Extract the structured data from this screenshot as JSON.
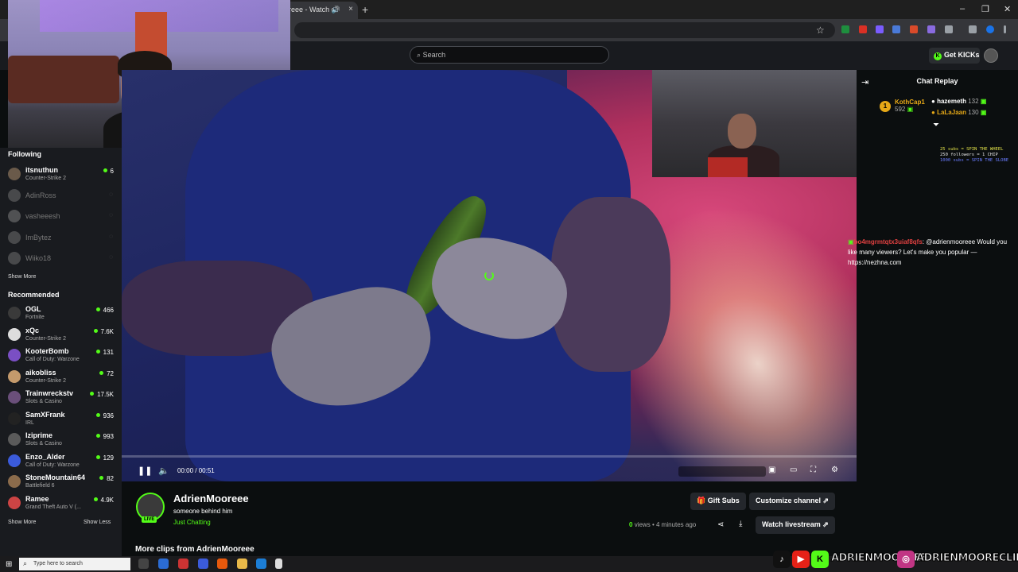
{
  "browser": {
    "tab_title": "reee - Watch cli",
    "speaker_icon": "speaker-icon",
    "close_icon": "×",
    "newtab": "+",
    "win_min": "–",
    "win_max": "❐",
    "win_close": "✕",
    "star": "☆"
  },
  "header": {
    "search_placeholder": "Search",
    "get_kicks": "Get KICKs",
    "accent": "#53fc18"
  },
  "sidebar": {
    "following_title": "Following",
    "following": [
      {
        "name": "itsnuthun",
        "game": "Counter-Strike 2",
        "viewers": "6",
        "live": true
      },
      {
        "name": "AdinRoss",
        "live": false
      },
      {
        "name": "vasheeesh",
        "live": false
      },
      {
        "name": "ImBytez",
        "live": false
      },
      {
        "name": "Wiiko18",
        "live": false
      }
    ],
    "show_more_1": "Show More",
    "recommended_title": "Recommended",
    "recommended": [
      {
        "name": "OGL",
        "game": "Fortnite",
        "viewers": "466"
      },
      {
        "name": "xQc",
        "game": "Counter-Strike 2",
        "viewers": "7.6K"
      },
      {
        "name": "KooterBomb",
        "game": "Call of Duty: Warzone",
        "viewers": "131"
      },
      {
        "name": "aikobliss",
        "game": "Counter-Strike 2",
        "viewers": "72"
      },
      {
        "name": "Trainwreckstv",
        "game": "Slots & Casino",
        "viewers": "17.5K"
      },
      {
        "name": "SamXFrank",
        "game": "IRL",
        "viewers": "936"
      },
      {
        "name": "Iziprime",
        "game": "Slots & Casino",
        "viewers": "993"
      },
      {
        "name": "Enzo_Alder",
        "game": "Call of Duty: Warzone",
        "viewers": "129"
      },
      {
        "name": "StoneMountain64",
        "game": "Battlefield 6",
        "viewers": "82"
      },
      {
        "name": "Ramee",
        "game": "Grand Theft Auto V (...",
        "viewers": "4.9K"
      }
    ],
    "show_more_2": "Show More",
    "show_less": "Show Less"
  },
  "player": {
    "current_time": "00:00",
    "separator": "/",
    "duration": "00:51",
    "progress": 0.0
  },
  "chat": {
    "title": "Chat Replay",
    "top_gifters": [
      {
        "rank": "1",
        "name": "KothCap1",
        "subs": "592",
        "color": "#e6a817"
      },
      {
        "name": "hazemeth",
        "subs": "132",
        "color": "#ffffff"
      },
      {
        "name": "LaLaJaan",
        "subs": "130",
        "color": "#e6a817"
      }
    ],
    "overlay_lines": [
      {
        "text": "25 subs = SPIN THE WHEEL",
        "color": "#e6e64a"
      },
      {
        "text": "250 followers = 1 CHIP",
        "color": "#e6e6e6"
      },
      {
        "text": "1000 subs = SPIN THE SLOBE",
        "color": "#6a7cff"
      }
    ],
    "message": {
      "user": "bo4mgrmtqtx3uiaf8qfs",
      "text": ": @adrienmooreee Would you like many viewers? Let's make you popular — https://nezhna.com"
    }
  },
  "clip": {
    "channel": "AdrienMooreee",
    "title": "someone behind him",
    "category": "Just Chatting",
    "live_badge": "LIVE",
    "gift_subs": "Gift Subs",
    "customize": "Customize channel",
    "views_count": "0",
    "views_label": "views",
    "dot": "•",
    "ago": "4 minutes ago",
    "watch_livestream": "Watch livestream",
    "more_clips": "More clips from AdrienMooreee"
  },
  "taskbar": {
    "search_placeholder": "Type here to search"
  },
  "socials": {
    "handle1": "ADRIENMOOREEE",
    "handle2": "ADRIENMOORECLIPS"
  }
}
